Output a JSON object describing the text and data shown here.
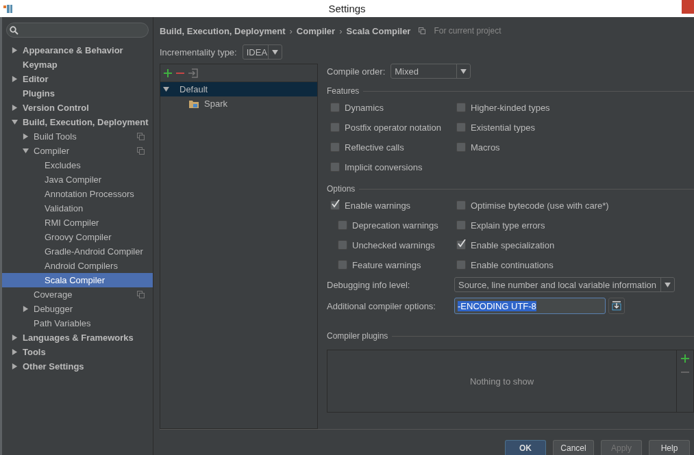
{
  "window": {
    "title": "Settings"
  },
  "sidebar": {
    "items": [
      {
        "label": "Appearance & Behavior",
        "expanded": false,
        "selected": false
      },
      {
        "label": "Keymap",
        "selected": false
      },
      {
        "label": "Editor",
        "expanded": false,
        "selected": false
      },
      {
        "label": "Plugins",
        "selected": false
      },
      {
        "label": "Version Control",
        "expanded": false,
        "selected": false
      },
      {
        "label": "Build, Execution, Deployment",
        "expanded": true,
        "selected": false,
        "children": [
          {
            "label": "Build Tools",
            "expanded": false,
            "project_scoped": true,
            "selected": false
          },
          {
            "label": "Compiler",
            "expanded": true,
            "project_scoped": true,
            "selected": false,
            "children": [
              {
                "label": "Excludes",
                "selected": false
              },
              {
                "label": "Java Compiler",
                "selected": false
              },
              {
                "label": "Annotation Processors",
                "selected": false
              },
              {
                "label": "Validation",
                "selected": false
              },
              {
                "label": "RMI Compiler",
                "selected": false
              },
              {
                "label": "Groovy Compiler",
                "selected": false
              },
              {
                "label": "Gradle-Android Compiler",
                "selected": false
              },
              {
                "label": "Android Compilers",
                "selected": false
              },
              {
                "label": "Scala Compiler",
                "selected": true
              }
            ]
          },
          {
            "label": "Coverage",
            "project_scoped": true,
            "selected": false
          },
          {
            "label": "Debugger",
            "expanded": false,
            "selected": false
          },
          {
            "label": "Path Variables",
            "selected": false
          }
        ]
      },
      {
        "label": "Languages & Frameworks",
        "expanded": false,
        "selected": false
      },
      {
        "label": "Tools",
        "expanded": false,
        "selected": false
      },
      {
        "label": "Other Settings",
        "expanded": false,
        "selected": false
      }
    ]
  },
  "breadcrumb": [
    "Build, Execution, Deployment",
    "Compiler",
    "Scala Compiler"
  ],
  "breadcrumb_separator": "›",
  "scope_note": "For current project",
  "incrementality": {
    "label": "Incrementality type:",
    "value": "IDEA"
  },
  "profiles": {
    "items": [
      {
        "label": "Default",
        "expanded": true,
        "selected": true,
        "children": [
          {
            "label": "Spark",
            "selected": false
          }
        ]
      }
    ]
  },
  "compile_order": {
    "label": "Compile order:",
    "value": "Mixed"
  },
  "features": {
    "title": "Features",
    "columns": [
      [
        {
          "label": "Dynamics",
          "checked": false
        },
        {
          "label": "Postfix operator notation",
          "checked": false
        },
        {
          "label": "Reflective calls",
          "checked": false
        },
        {
          "label": "Implicit conversions",
          "checked": false
        }
      ],
      [
        {
          "label": "Higher-kinded types",
          "checked": false
        },
        {
          "label": "Existential types",
          "checked": false
        },
        {
          "label": "Macros",
          "checked": false
        }
      ]
    ]
  },
  "options": {
    "title": "Options",
    "columns": [
      [
        {
          "label": "Enable warnings",
          "checked": true,
          "children": [
            {
              "label": "Deprecation warnings",
              "checked": false
            },
            {
              "label": "Unchecked warnings",
              "checked": false
            },
            {
              "label": "Feature warnings",
              "checked": false
            }
          ]
        }
      ],
      [
        {
          "label": "Optimise bytecode (use with care*)",
          "checked": false
        },
        {
          "label": "Explain type errors",
          "checked": false
        },
        {
          "label": "Enable specialization",
          "checked": true
        },
        {
          "label": "Enable continuations",
          "checked": false
        }
      ]
    ]
  },
  "debugging": {
    "label": "Debugging info level:",
    "value": "Source, line number and local variable information"
  },
  "additional": {
    "label": "Additional compiler options:",
    "value": "-ENCODING UTF-8"
  },
  "plugins": {
    "title": "Compiler plugins",
    "empty_text": "Nothing to show"
  },
  "buttons": [
    {
      "label": "OK",
      "kind": "default",
      "disabled": false
    },
    {
      "label": "Cancel",
      "kind": "normal",
      "disabled": false
    },
    {
      "label": "Apply",
      "kind": "normal",
      "disabled": true
    },
    {
      "label": "Help",
      "kind": "normal",
      "disabled": false
    }
  ]
}
